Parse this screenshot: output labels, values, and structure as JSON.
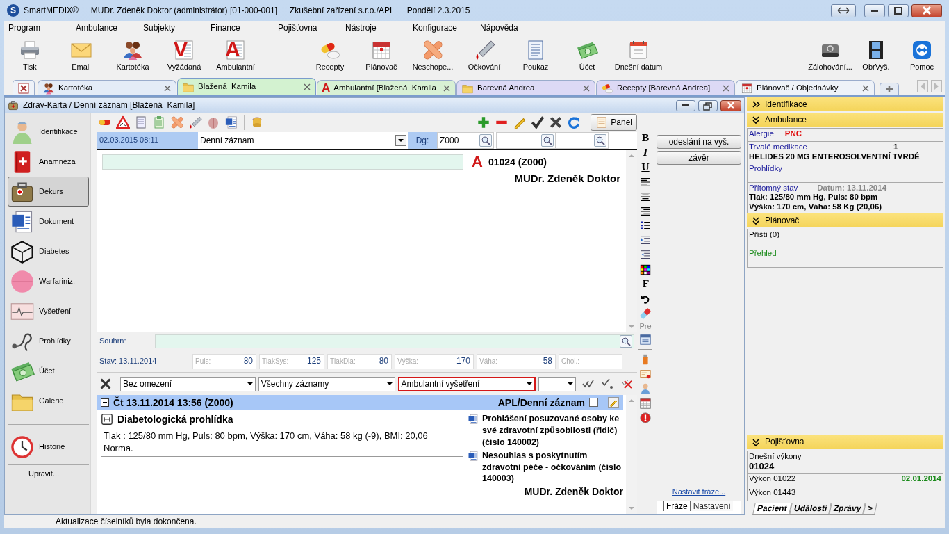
{
  "window": {
    "logo": "S",
    "app_name": "SmartMEDIX®",
    "user": "MUDr. Zdeněk Doktor (administrátor) [01-000-001]",
    "facility": "Zkušební zařízení s.r.o./APL",
    "date": "Pondělí 2.3.2015"
  },
  "menu": [
    "Program",
    "Ambulance",
    "Subjekty",
    "Finance",
    "Pojišťovna",
    "Nástroje",
    "Konfigurace",
    "Nápověda"
  ],
  "toolbar_groups": [
    [
      {
        "label": "Tisk"
      },
      {
        "label": "Email"
      },
      {
        "label": "Kartotéka"
      },
      {
        "label": "Vyžádaná",
        "glyph": "V"
      },
      {
        "label": "Ambulantní",
        "glyph": "A"
      }
    ],
    [
      {
        "label": "Recepty"
      },
      {
        "label": "Plánovač"
      },
      {
        "label": "Neschope..."
      },
      {
        "label": "Očkování"
      },
      {
        "label": "Poukaz"
      },
      {
        "label": "Účet"
      },
      {
        "label": "Dnešní datum"
      }
    ],
    [
      {
        "label": "Zálohování..."
      },
      {
        "label": "ObrVyš."
      },
      {
        "label": "Pomoc"
      }
    ]
  ],
  "tabs": [
    {
      "label": "Kartotéka",
      "color": "#e4ecf7",
      "selected": false
    },
    {
      "label": "Blažená  Kamila",
      "color": "#d3f2d0",
      "selected": true
    },
    {
      "label": "Ambulantní [Blažená  Kamila",
      "glyph": "A",
      "color": "#d8f0d4",
      "selected": false
    },
    {
      "label": "Barevná Andrea",
      "color": "#dcd9f5",
      "selected": false
    },
    {
      "label": "Recepty [Barevná Andrea]",
      "color": "#dcd9f5",
      "selected": false
    },
    {
      "label": "Plánovač / Objednávky",
      "color": "#eef2f8",
      "selected": false
    }
  ],
  "record_window": {
    "title": "Zdrav-Karta / Denní záznam [Blažená  Kamila]"
  },
  "nav": [
    {
      "label": "Identifikace",
      "selected": false
    },
    {
      "label": "Anamnéza",
      "selected": false
    },
    {
      "label": "Dekurs",
      "selected": true
    },
    {
      "label": "Dokument",
      "selected": false
    },
    {
      "label": "Diabetes",
      "selected": false
    },
    {
      "label": "Warfariniz.",
      "selected": false
    },
    {
      "label": "Vyšetření",
      "selected": false
    },
    {
      "label": "Prohlídky",
      "selected": false
    },
    {
      "label": "Účet",
      "selected": false
    },
    {
      "label": "Galerie",
      "selected": false
    }
  ],
  "nav_bottom": [
    {
      "label": "Historie",
      "selected": false
    }
  ],
  "nav_edit": "Upravit...",
  "panel_button": "Panel",
  "entry": {
    "datetime": "02.03.2015 08:11",
    "type": "Denní záznam",
    "dg_label": "Dg:",
    "dg": "Z000",
    "code_glyph": "A",
    "code_line": "01024 (Z000)",
    "doctor": "MUDr. Zdeněk Doktor",
    "summary_label": "Souhrn:"
  },
  "vitals": {
    "stav": "Stav: 13.11.2014",
    "fields": [
      {
        "label": "Puls:",
        "value": "80"
      },
      {
        "label": "TlakSys:",
        "value": "125"
      },
      {
        "label": "TlakDia:",
        "value": "80"
      },
      {
        "label": "Výška:",
        "value": "170"
      },
      {
        "label": "Váha:",
        "value": "58"
      },
      {
        "label": "Chol.:"
      }
    ]
  },
  "filters": [
    {
      "value": "Bez omezení",
      "highlighted": false
    },
    {
      "value": "Všechny záznamy",
      "highlighted": false
    },
    {
      "value": "Ambulantní vyšetření",
      "highlighted": true
    }
  ],
  "records": [
    {
      "header": "Čt 13.11.2014 13:56 (Z000)",
      "type": "APL/Denní záznam",
      "expanded": true,
      "checked": false,
      "title": "Diabetologická prohlídka",
      "text": [
        "Tlak : 125/80 mm Hg, Puls: 80 bpm, Výška: 170 cm, Váha: 58 kg (-9), BMI: 20,06",
        "Norma."
      ],
      "documents": [
        "Prohlášení posuzované osoby ke své zdravotní způsobilosti (řidič) (číslo 140002)",
        "Nesouhlas s poskytnutím zdravotní péče - očkováním (číslo 140003)"
      ],
      "doctor": "MUDr. Zdeněk Doktor"
    }
  ],
  "format_bar": {
    "glyphs": [
      "B",
      "I",
      "U"
    ],
    "font_glyph": "F",
    "pre": "Pre"
  },
  "side_buttons": [
    "odeslání na vyš.",
    "závěr"
  ],
  "phrase_link": "Nastavit fráze...",
  "side_tabs": [
    {
      "label": "Fráze",
      "selected": true
    },
    {
      "label": "Nastavení",
      "selected": false
    }
  ],
  "info_sections": [
    {
      "title": "Identifikace",
      "expanded": false
    },
    {
      "title": "Ambulance",
      "expanded": true,
      "rows": [
        {
          "kind": "pair",
          "label": "Alergie",
          "value": "PNC"
        },
        {
          "kind": "medication",
          "label": "Trvalé medikace",
          "count": "1",
          "text": "HELIDES 20 MG ENTEROSOLVENTNÍ TVRDÉ"
        },
        {
          "kind": "link",
          "label": "Prohlídky",
          "color": "#1c1c9c"
        },
        {
          "kind": "status",
          "label": "Přítomný stav",
          "date": "Datum: 13.11.2014",
          "lines": [
            "Tlak: 125/80 mm Hg, Puls: 80 bpm",
            "Výška: 170 cm, Váha: 58 Kg (20,06)"
          ]
        }
      ]
    },
    {
      "title": "Plánovač",
      "expanded": true,
      "rows": [
        {
          "kind": "link",
          "label": "Příští (0)",
          "color": "#000000"
        },
        {
          "kind": "link",
          "label": "Přehled",
          "color": "#1a8a1a"
        }
      ]
    }
  ],
  "info_bottom_sections": [
    {
      "title": "Pojišťovna",
      "expanded": true,
      "rows": [
        {
          "kind": "code",
          "label": "Dnešní výkony",
          "value": "01024"
        },
        {
          "kind": "item",
          "label": "Výkon 01022",
          "date": "02.01.2014"
        },
        {
          "kind": "item",
          "label": "Výkon 01443"
        }
      ]
    }
  ],
  "info_tabs": [
    {
      "label": "Pacient",
      "selected": true
    },
    {
      "label": "Události",
      "selected": false
    },
    {
      "label": "Zprávy",
      "selected": false
    },
    {
      "label": ">",
      "selected": false
    }
  ],
  "status_bar": "Aktualizace číselníků byla dokončena."
}
